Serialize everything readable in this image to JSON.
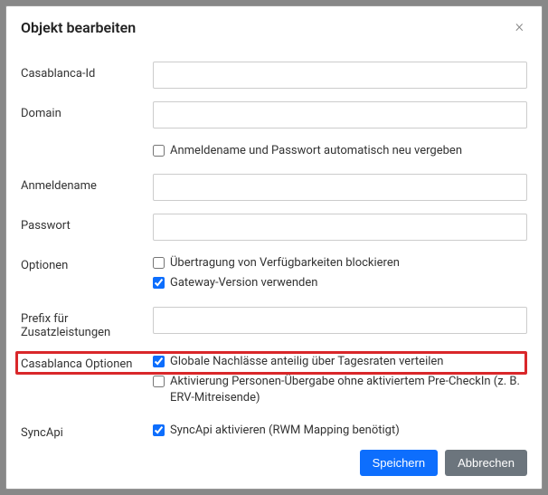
{
  "modal": {
    "title": "Objekt bearbeiten",
    "close": "×"
  },
  "fields": {
    "casablanca_id": {
      "label": "Casablanca-Id",
      "value": ""
    },
    "domain": {
      "label": "Domain",
      "value": ""
    },
    "auto_cred": {
      "label": "Anmeldename und Passwort automatisch neu vergeben",
      "checked": false
    },
    "anmeldename": {
      "label": "Anmeldename",
      "value": ""
    },
    "passwort": {
      "label": "Passwort",
      "value": ""
    },
    "optionen": {
      "label": "Optionen",
      "opt1": {
        "label": "Übertragung von Verfügbarkeiten blockieren",
        "checked": false
      },
      "opt2": {
        "label": "Gateway-Version verwenden",
        "checked": true
      }
    },
    "prefix": {
      "label": "Prefix für Zusatzleistungen",
      "value": ""
    },
    "casablanca_optionen": {
      "label": "Casablanca Optionen",
      "opt1": {
        "label": "Globale Nachlässe anteilig über Tagesraten verteilen",
        "checked": true
      },
      "opt2": {
        "label": "Aktivierung Personen-Übergabe ohne aktiviertem Pre-CheckIn (z. B. ERV-Mitreisende)",
        "checked": false
      }
    },
    "syncapi": {
      "label": "SyncApi",
      "opt1": {
        "label": "SyncApi aktivieren (RWM Mapping benötigt)",
        "checked": true
      }
    }
  },
  "footer": {
    "save": "Speichern",
    "cancel": "Abbrechen"
  }
}
